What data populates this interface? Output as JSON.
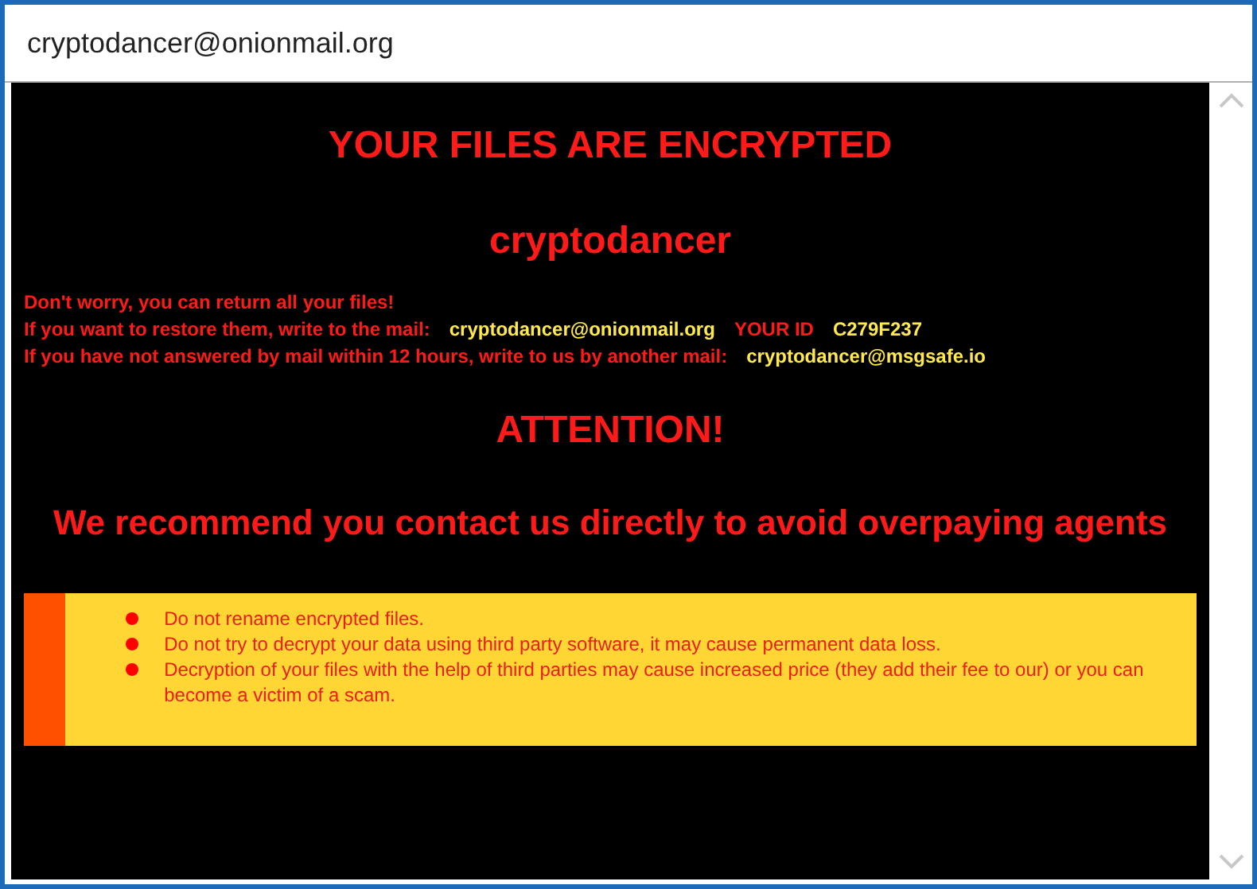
{
  "window": {
    "title": "cryptodancer@onionmail.org"
  },
  "heading": "YOUR FILES ARE ENCRYPTED",
  "name": "cryptodancer",
  "info_lines": [
    {
      "segments": [
        {
          "kind": "label",
          "text": "Don't worry, you can return all your files!"
        }
      ]
    },
    {
      "segments": [
        {
          "kind": "label",
          "text": "If you want to restore them, write to the mail:"
        },
        {
          "kind": "value",
          "text": "cryptodancer@onionmail.org"
        },
        {
          "kind": "label",
          "text": "YOUR ID"
        },
        {
          "kind": "value",
          "text": "C279F237"
        }
      ]
    },
    {
      "segments": [
        {
          "kind": "label",
          "text": "If you have not answered by mail within 12 hours, write to us by another mail:"
        },
        {
          "kind": "value",
          "text": "cryptodancer@msgsafe.io"
        }
      ]
    }
  ],
  "attention": "ATTENTION!",
  "recommendation": "We recommend you contact us directly to avoid overpaying agents",
  "warnings": [
    "Do not rename encrypted files.",
    "Do not try to decrypt your data using third party software, it may cause permanent data loss.",
    "Decryption of your files with the help of third parties may cause increased price (they add their fee to our) or you can become a victim of a scam."
  ]
}
